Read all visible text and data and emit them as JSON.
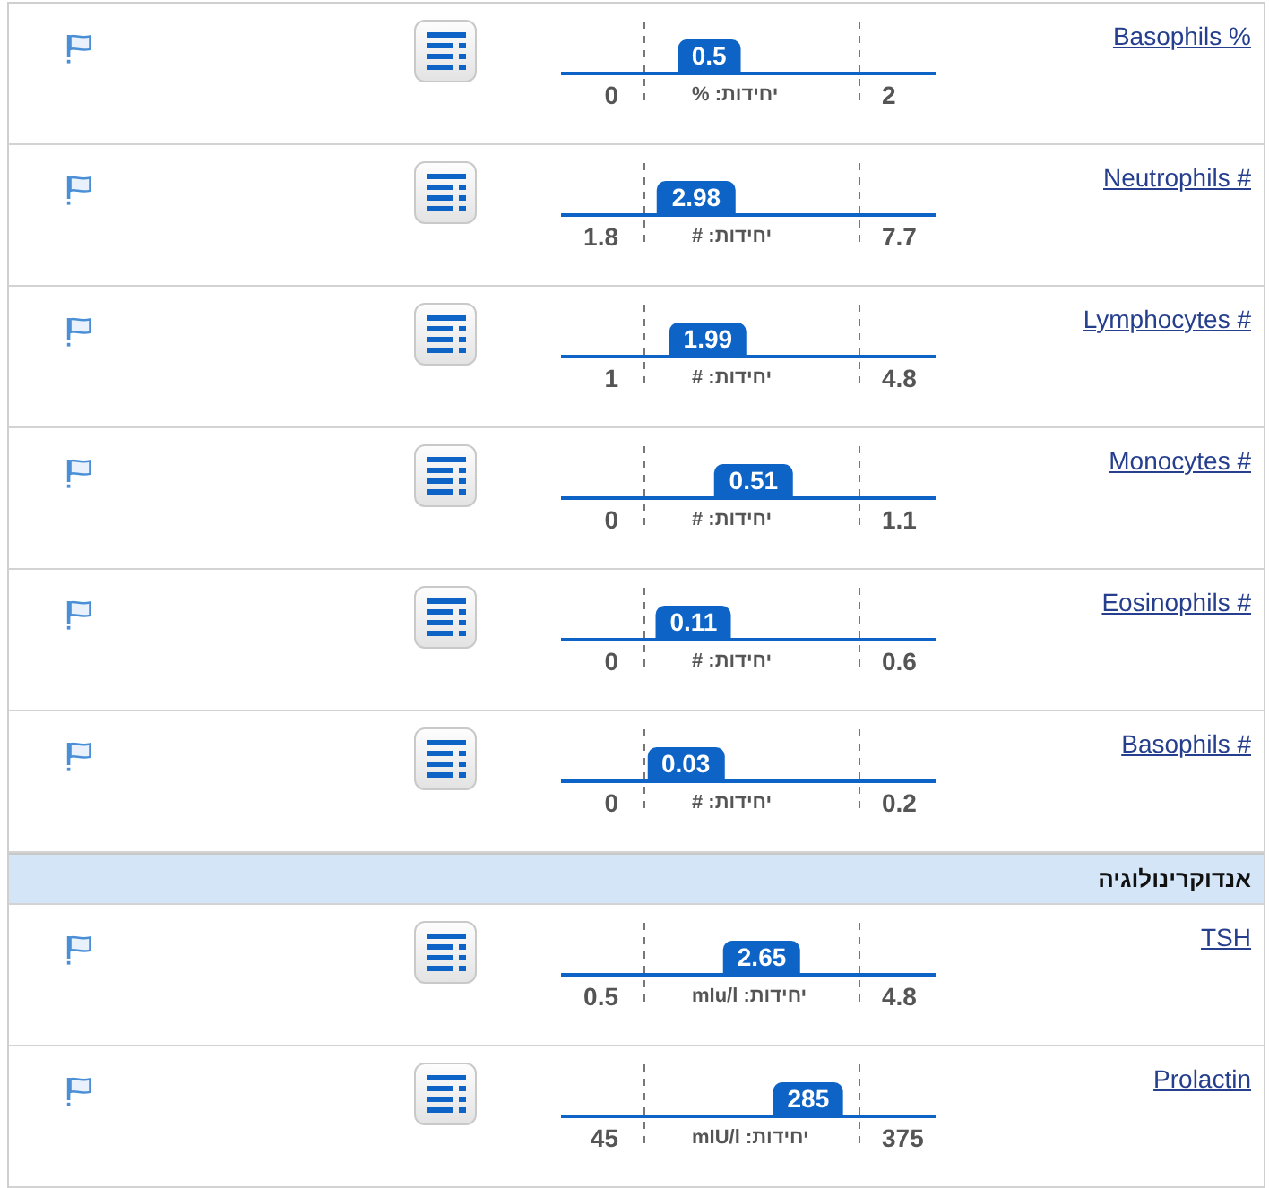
{
  "rows": [
    {
      "kind": "test",
      "name": "Basophils %",
      "value": "0.5",
      "level": 0.395,
      "low": "0",
      "high": "2",
      "unit": "יחידות: %"
    },
    {
      "kind": "test",
      "name": "Neutrophils #",
      "value": "2.98",
      "level": 0.361,
      "low": "1.8",
      "high": "7.7",
      "unit": "יחידות: #"
    },
    {
      "kind": "test",
      "name": "Lymphocytes #",
      "value": "1.99",
      "level": 0.392,
      "low": "1",
      "high": "4.8",
      "unit": "יחידות: #"
    },
    {
      "kind": "test",
      "name": "Monocytes #",
      "value": "0.51",
      "level": 0.514,
      "low": "0",
      "high": "1.1",
      "unit": "יחידות: #"
    },
    {
      "kind": "test",
      "name": "Eosinophils #",
      "value": "0.11",
      "level": 0.354,
      "low": "0",
      "high": "0.6",
      "unit": "יחידות: #"
    },
    {
      "kind": "test",
      "name": "Basophils #",
      "value": "0.03",
      "level": 0.333,
      "low": "0",
      "high": "0.2",
      "unit": "יחידות: #"
    },
    {
      "kind": "section",
      "title": "אנדוקרינולוגיה"
    },
    {
      "kind": "test",
      "name": "TSH",
      "value": "2.65",
      "level": 0.536,
      "low": "0.5",
      "high": "4.8",
      "unit": "יחידות: mIu/l"
    },
    {
      "kind": "test",
      "name": "Prolactin",
      "value": "285",
      "level": 0.66,
      "low": "45",
      "high": "375",
      "unit": "יחידות: mIU/l"
    }
  ]
}
